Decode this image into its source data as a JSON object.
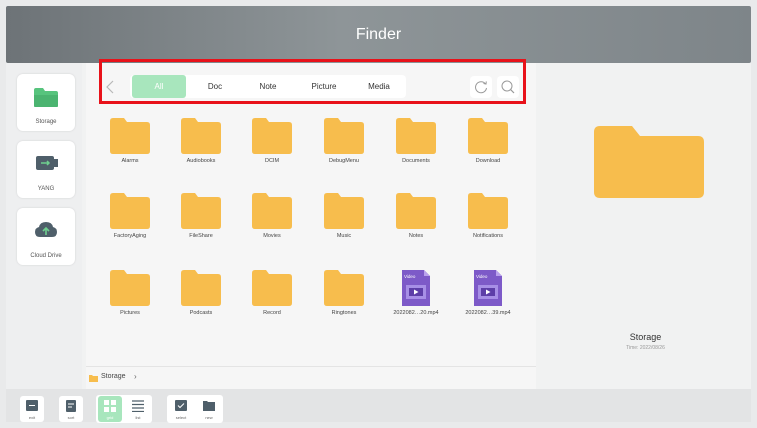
{
  "window": {
    "title": "Finder"
  },
  "sidebar": {
    "items": [
      {
        "label": "Storage",
        "icon": "folder-icon"
      },
      {
        "label": "YANG",
        "icon": "usb-drive-icon"
      },
      {
        "label": "Cloud Drive",
        "icon": "cloud-upload-icon"
      }
    ]
  },
  "toolbar": {
    "tabs": [
      {
        "label": "All",
        "active": true
      },
      {
        "label": "Doc",
        "active": false
      },
      {
        "label": "Note",
        "active": false
      },
      {
        "label": "Picture",
        "active": false
      },
      {
        "label": "Media",
        "active": false
      }
    ],
    "refresh_icon": "refresh-icon",
    "search_icon": "search-icon"
  },
  "files": [
    {
      "name": "Alarms",
      "type": "folder"
    },
    {
      "name": "Audiobooks",
      "type": "folder"
    },
    {
      "name": "DCIM",
      "type": "folder"
    },
    {
      "name": "DebugMenu",
      "type": "folder"
    },
    {
      "name": "Documents",
      "type": "folder"
    },
    {
      "name": "Download",
      "type": "folder"
    },
    {
      "name": "FactoryAging",
      "type": "folder"
    },
    {
      "name": "FileShare",
      "type": "folder"
    },
    {
      "name": "Movies",
      "type": "folder"
    },
    {
      "name": "Music",
      "type": "folder"
    },
    {
      "name": "Notes",
      "type": "folder"
    },
    {
      "name": "Notifications",
      "type": "folder"
    },
    {
      "name": "Pictures",
      "type": "folder"
    },
    {
      "name": "Podcasts",
      "type": "folder"
    },
    {
      "name": "Record",
      "type": "folder"
    },
    {
      "name": "Ringtones",
      "type": "folder"
    },
    {
      "name": "2022082…20.mp4",
      "type": "video",
      "badge": "Video"
    },
    {
      "name": "2022082…39.mp4",
      "type": "video",
      "badge": "Video"
    }
  ],
  "path": {
    "segment": "Storage",
    "separator": "›"
  },
  "preview": {
    "name": "Storage",
    "meta": "Time: 2022/08/26"
  },
  "bottombar": {
    "buttons": [
      {
        "label": "exit",
        "icon": "exit-icon"
      },
      {
        "label": "sort",
        "icon": "sort-icon"
      },
      {
        "label": "grid",
        "icon": "grid-icon",
        "active": true
      },
      {
        "label": "list",
        "icon": "list-icon"
      },
      {
        "label": "select",
        "icon": "select-icon"
      },
      {
        "label": "new",
        "icon": "new-folder-icon"
      }
    ]
  },
  "colors": {
    "folder": "#f7bd4d",
    "active_tab": "#a8e6bd",
    "highlight_box": "#e8121a",
    "video": "#7d5ac8",
    "active_button": "#a8e6bd"
  }
}
